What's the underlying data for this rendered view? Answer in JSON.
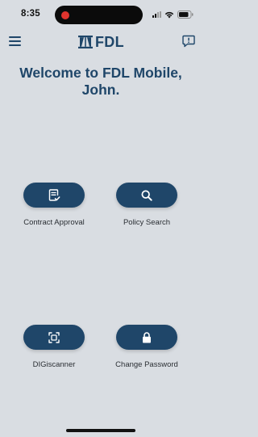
{
  "status_bar": {
    "time": "8:35"
  },
  "header": {
    "brand_name": "FDL",
    "menu_icon": "hamburger-menu-icon",
    "feedback_icon": "feedback-exclamation-icon"
  },
  "welcome": {
    "line1": "Welcome to FDL Mobile,",
    "line2": "John."
  },
  "actions": [
    {
      "label": "Contract Approval",
      "icon": "document-check-icon"
    },
    {
      "label": "Policy Search",
      "icon": "search-icon"
    },
    {
      "label": "DIGiscanner",
      "icon": "scan-frame-icon"
    },
    {
      "label": "Change Password",
      "icon": "lock-icon"
    }
  ],
  "colors": {
    "brand": "#1f4669",
    "background": "#d9dde2",
    "recording_dot": "#e0342e"
  }
}
